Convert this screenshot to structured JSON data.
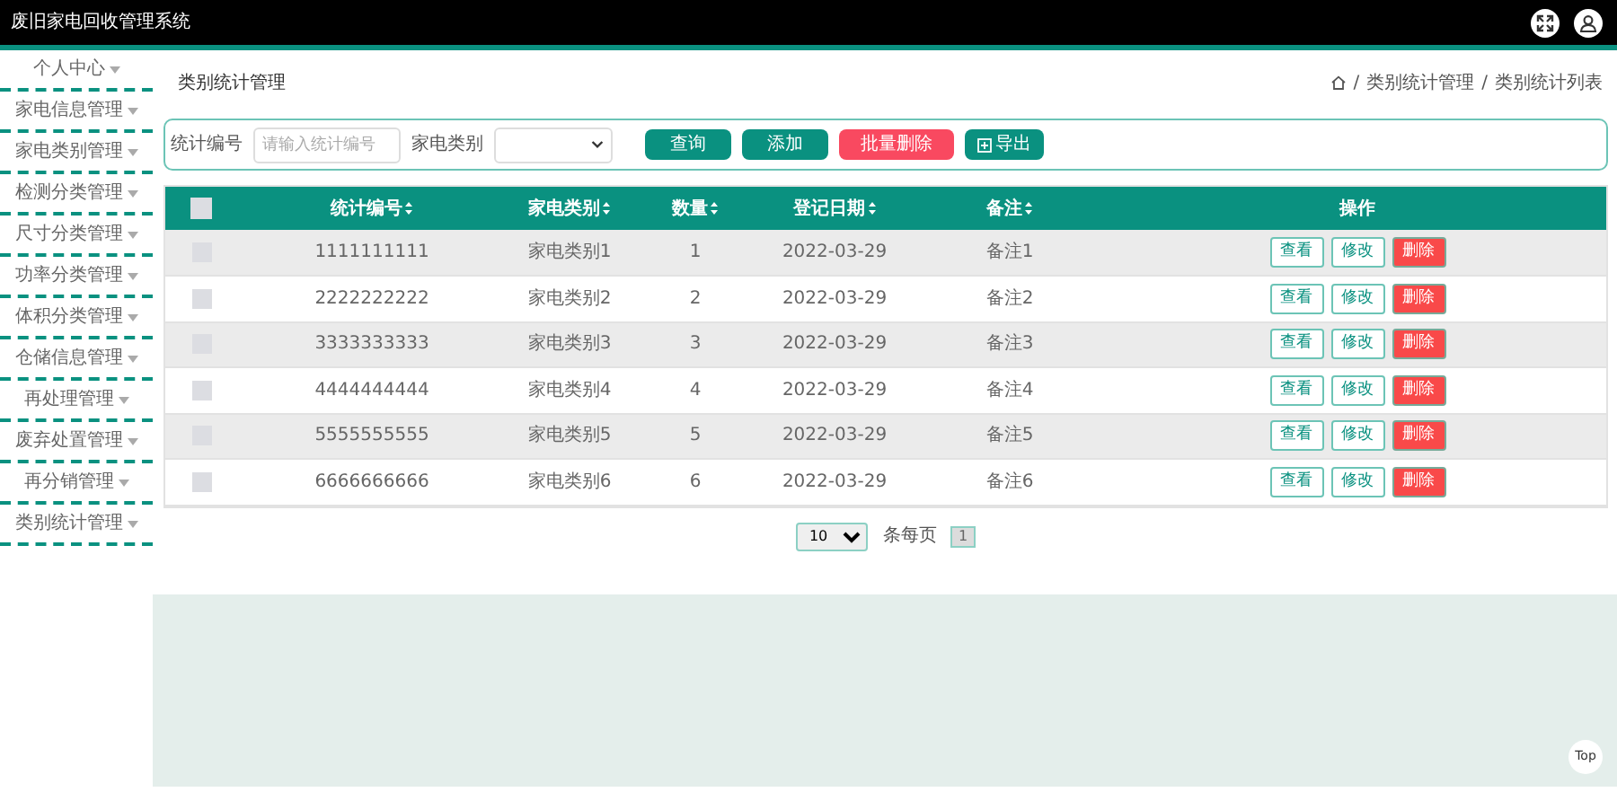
{
  "header": {
    "title": "废旧家电回收管理系统"
  },
  "sidebar": {
    "items": [
      {
        "label": "个人中心"
      },
      {
        "label": "家电信息管理"
      },
      {
        "label": "家电类别管理"
      },
      {
        "label": "检测分类管理"
      },
      {
        "label": "尺寸分类管理"
      },
      {
        "label": "功率分类管理"
      },
      {
        "label": "体积分类管理"
      },
      {
        "label": "仓储信息管理"
      },
      {
        "label": "再处理管理"
      },
      {
        "label": "废弃处置管理"
      },
      {
        "label": "再分销管理"
      },
      {
        "label": "类别统计管理"
      }
    ]
  },
  "page_title": "类别统计管理",
  "breadcrumb": {
    "separator": "/",
    "items": [
      "类别统计管理",
      "类别统计列表"
    ]
  },
  "search": {
    "fields": [
      {
        "kind": "input",
        "label": "统计编号",
        "placeholder": "请输入统计编号"
      },
      {
        "kind": "select",
        "label": "家电类别"
      }
    ],
    "buttons": [
      {
        "kind": "primary",
        "label": "查询"
      },
      {
        "kind": "primary",
        "label": "添加"
      },
      {
        "kind": "danger",
        "label": "批量删除"
      },
      {
        "kind": "export",
        "label": "导出"
      }
    ]
  },
  "table": {
    "header_checked": false,
    "columns": [
      "统计编号",
      "家电类别",
      "数量",
      "登记日期",
      "备注"
    ],
    "action_column": "操作",
    "rows": [
      {
        "checked": false,
        "cells": [
          "1111111111",
          "家电类别1",
          "1",
          "2022-03-29",
          "备注1"
        ],
        "actions": [
          {
            "kind": "view",
            "label": "查看"
          },
          {
            "kind": "edit",
            "label": "修改"
          },
          {
            "kind": "delete",
            "label": "删除"
          }
        ]
      },
      {
        "checked": false,
        "cells": [
          "2222222222",
          "家电类别2",
          "2",
          "2022-03-29",
          "备注2"
        ],
        "actions": [
          {
            "kind": "view",
            "label": "查看"
          },
          {
            "kind": "edit",
            "label": "修改"
          },
          {
            "kind": "delete",
            "label": "删除"
          }
        ]
      },
      {
        "checked": false,
        "cells": [
          "3333333333",
          "家电类别3",
          "3",
          "2022-03-29",
          "备注3"
        ],
        "actions": [
          {
            "kind": "view",
            "label": "查看"
          },
          {
            "kind": "edit",
            "label": "修改"
          },
          {
            "kind": "delete",
            "label": "删除"
          }
        ]
      },
      {
        "checked": false,
        "cells": [
          "4444444444",
          "家电类别4",
          "4",
          "2022-03-29",
          "备注4"
        ],
        "actions": [
          {
            "kind": "view",
            "label": "查看"
          },
          {
            "kind": "edit",
            "label": "修改"
          },
          {
            "kind": "delete",
            "label": "删除"
          }
        ]
      },
      {
        "checked": false,
        "cells": [
          "5555555555",
          "家电类别5",
          "5",
          "2022-03-29",
          "备注5"
        ],
        "actions": [
          {
            "kind": "view",
            "label": "查看"
          },
          {
            "kind": "edit",
            "label": "修改"
          },
          {
            "kind": "delete",
            "label": "删除"
          }
        ]
      },
      {
        "checked": false,
        "cells": [
          "6666666666",
          "家电类别6",
          "6",
          "2022-03-29",
          "备注6"
        ],
        "actions": [
          {
            "kind": "view",
            "label": "查看"
          },
          {
            "kind": "edit",
            "label": "修改"
          },
          {
            "kind": "delete",
            "label": "删除"
          }
        ]
      }
    ]
  },
  "pagination": {
    "page_size": "10",
    "page_size_label": "条每页",
    "pages": [
      {
        "label": "1",
        "selected": true
      }
    ]
  },
  "top_button": "Top"
}
